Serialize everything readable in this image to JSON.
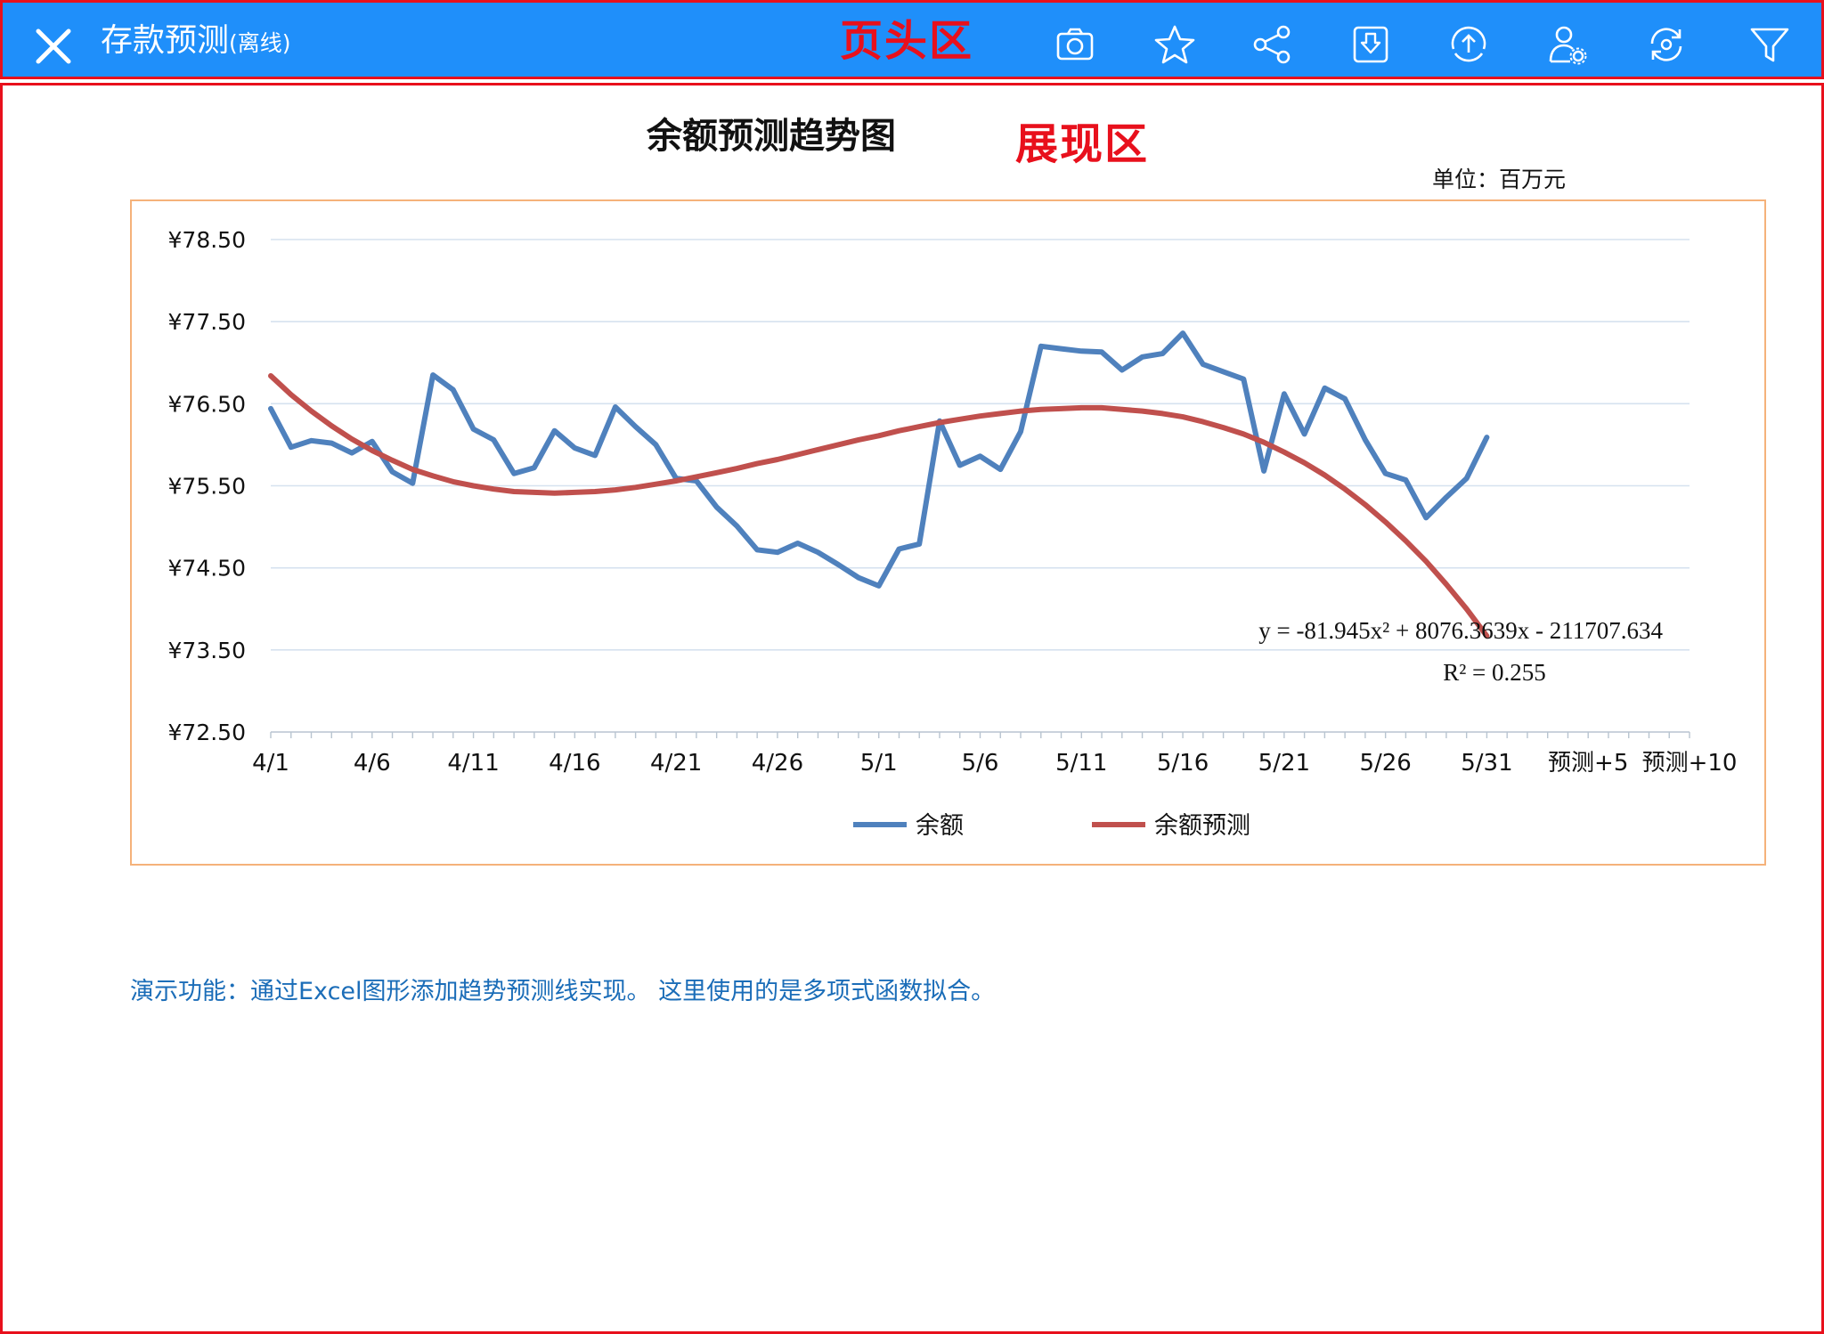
{
  "header": {
    "title": "存款预测",
    "title_suffix": "(离线)",
    "zone_label": "页头区",
    "icons": [
      "close-icon",
      "camera-icon",
      "star-icon",
      "share-icon",
      "download-icon",
      "upload-icon",
      "user-settings-icon",
      "refresh-icon",
      "filter-icon"
    ],
    "background_color": "#1f8ffa"
  },
  "content": {
    "zone_label": "展现区",
    "chart_title": "余额预测趋势图",
    "unit_label": "单位：百万元",
    "description": "演示功能：通过Excel图形添加趋势预测线实现。 这里使用的是多项式函数拟合。"
  },
  "chart_data": {
    "type": "line",
    "title": "余额预测趋势图",
    "unit": "单位：百万元",
    "ylim": [
      72.5,
      78.5
    ],
    "y_ticks": [
      "¥78.50",
      "¥77.50",
      "¥76.50",
      "¥75.50",
      "¥74.50",
      "¥73.50",
      "¥72.50"
    ],
    "x_tick_labels": [
      "4/1",
      "4/6",
      "4/11",
      "4/16",
      "4/21",
      "4/26",
      "5/1",
      "5/6",
      "5/11",
      "5/16",
      "5/21",
      "5/26",
      "5/31",
      "预测+5",
      "预测+10"
    ],
    "grid": true,
    "legend_position": "bottom",
    "series": [
      {
        "name": "余额",
        "color": "#4f81bd",
        "values": [
          76.44,
          75.97,
          76.05,
          76.02,
          75.9,
          76.04,
          75.67,
          75.53,
          76.85,
          76.67,
          76.19,
          76.06,
          75.65,
          75.72,
          76.17,
          75.96,
          75.87,
          76.46,
          76.22,
          76.0,
          75.59,
          75.56,
          75.24,
          75.01,
          74.72,
          74.69,
          74.8,
          74.69,
          74.54,
          74.38,
          74.28,
          74.73,
          74.79,
          76.29,
          75.75,
          75.86,
          75.7,
          76.16,
          77.2,
          77.17,
          77.14,
          77.13,
          76.91,
          77.07,
          77.11,
          77.36,
          76.98,
          76.89,
          76.8,
          75.68,
          76.62,
          76.13,
          76.69,
          76.56,
          76.06,
          75.65,
          75.57,
          75.11,
          75.36,
          75.59,
          76.09
        ]
      },
      {
        "name": "余额预测",
        "color": "#c0504d",
        "values": [
          76.84,
          76.61,
          76.41,
          76.23,
          76.07,
          75.93,
          75.81,
          75.7,
          75.62,
          75.55,
          75.5,
          75.46,
          75.43,
          75.42,
          75.41,
          75.42,
          75.43,
          75.45,
          75.48,
          75.52,
          75.56,
          75.61,
          75.66,
          75.71,
          75.77,
          75.82,
          75.88,
          75.94,
          76.0,
          76.06,
          76.11,
          76.17,
          76.22,
          76.27,
          76.31,
          76.35,
          76.38,
          76.41,
          76.43,
          76.44,
          76.45,
          76.45,
          76.43,
          76.41,
          76.38,
          76.34,
          76.28,
          76.21,
          76.13,
          76.03,
          75.91,
          75.78,
          75.63,
          75.46,
          75.27,
          75.06,
          74.83,
          74.58,
          74.3,
          74.0,
          73.67
        ]
      }
    ],
    "trendline_equation": "y = -81.945x² + 8076.3639x - 211707.634",
    "r_squared": "R² = 0.255"
  }
}
